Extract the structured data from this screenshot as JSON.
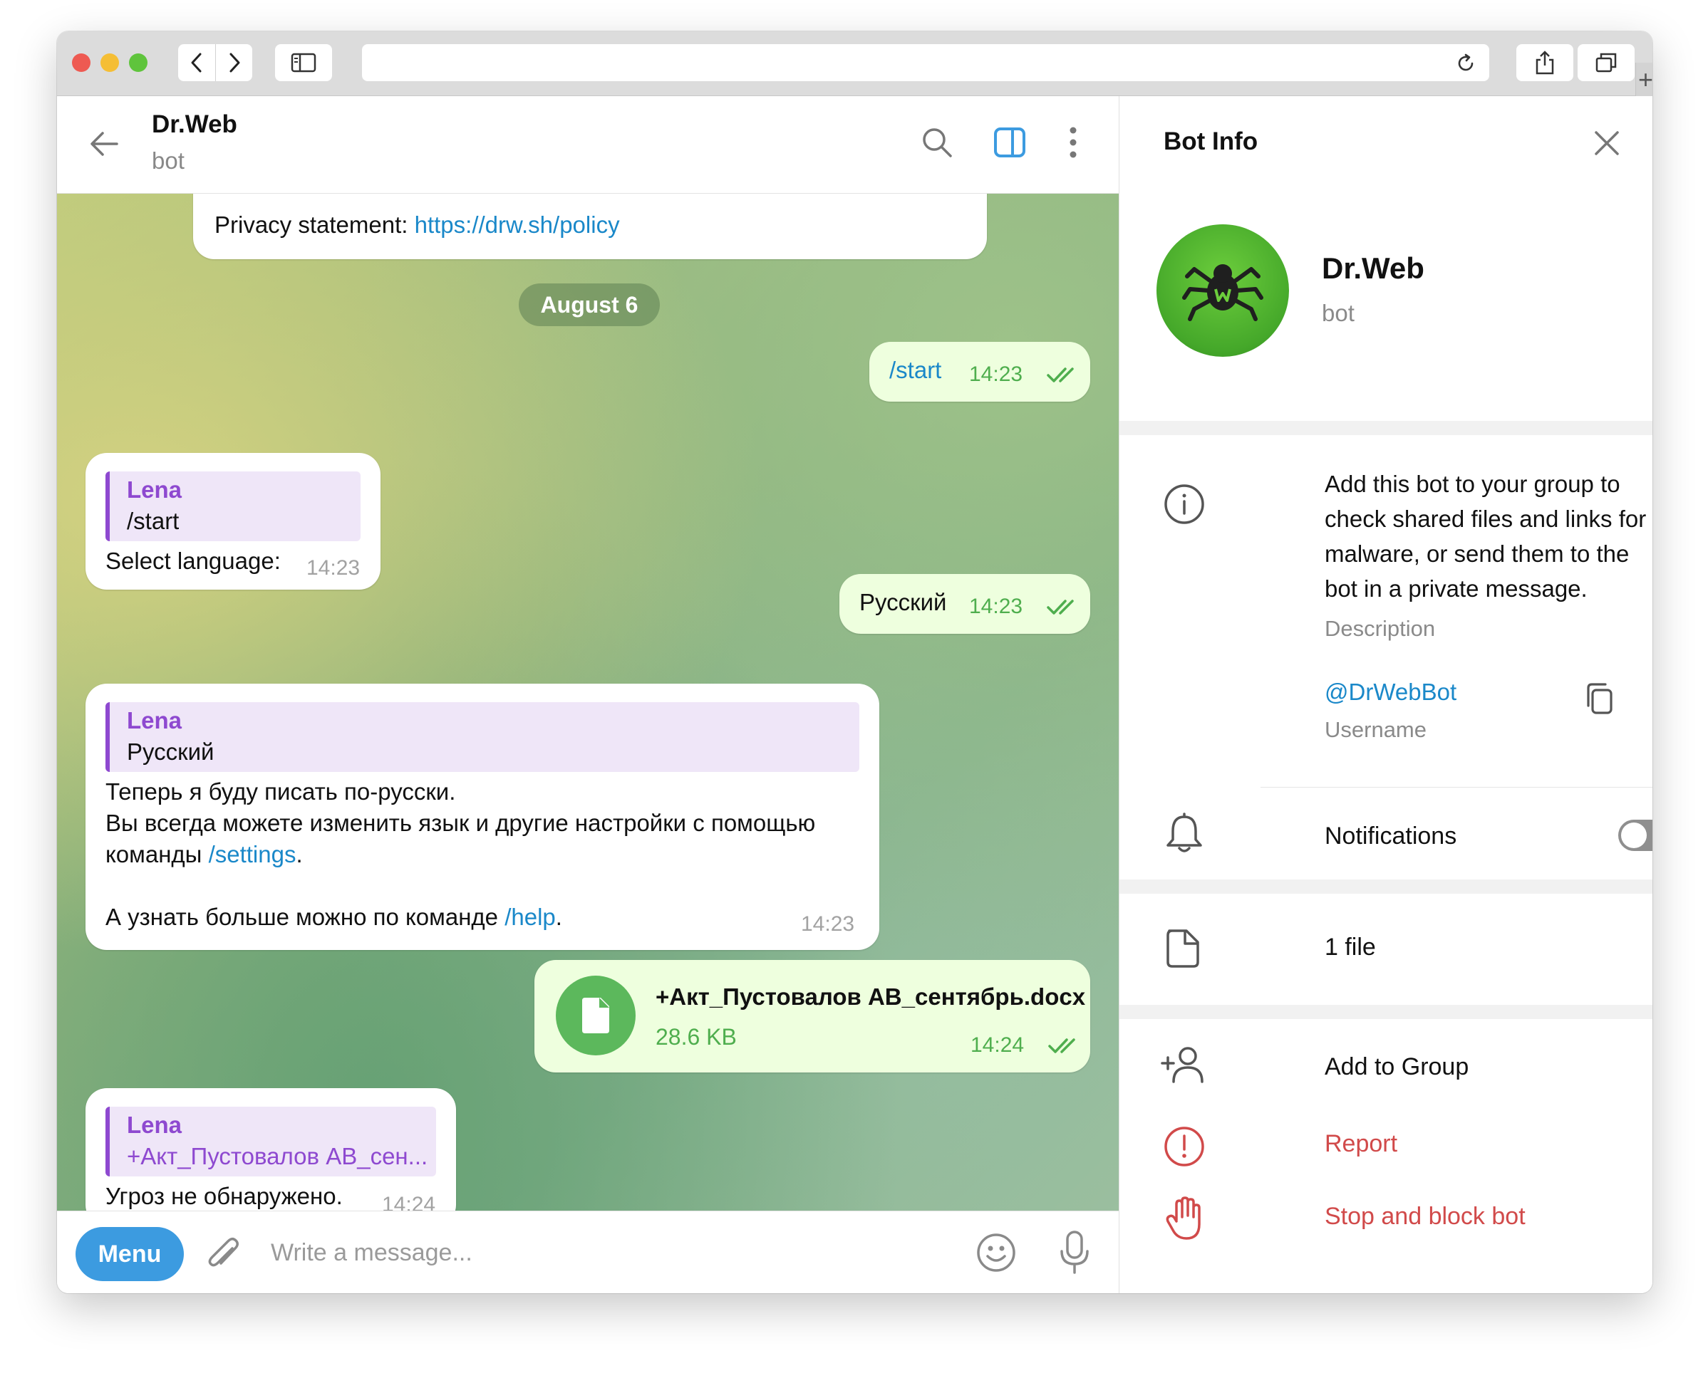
{
  "chat": {
    "title": "Dr.Web",
    "subtitle": "bot",
    "date_pill": "August 6",
    "messages": {
      "privacy_label": "Privacy statement: ",
      "privacy_link": "https://drw.sh/policy",
      "out_start": {
        "text": "/start",
        "time": "14:23"
      },
      "in_select": {
        "reply_name": "Lena",
        "reply_text": "/start",
        "text": "Select language:",
        "time": "14:23"
      },
      "out_russian": {
        "text": "Русский",
        "time": "14:23"
      },
      "in_russian": {
        "reply_name": "Lena",
        "reply_text": "Русский",
        "line1": "Теперь я буду писать по-русски.",
        "line2": "Вы всегда можете изменить язык и другие настройки с помощью",
        "line3_pre": "команды ",
        "line3_link": "/settings",
        "line3_post": ".",
        "line4_pre": "А узнать больше можно по команде ",
        "line4_link": "/help",
        "line4_post": ".",
        "time": "14:23"
      },
      "out_file": {
        "name": "+Акт_Пустовалов АВ_сентябрь.docx",
        "size": "28.6 KB",
        "time": "14:24"
      },
      "in_result": {
        "reply_name": "Lena",
        "reply_text": "+Акт_Пустовалов АВ_сен...",
        "text": "Угроз не обнаружено.",
        "time": "14:24"
      }
    }
  },
  "composer": {
    "menu_label": "Menu",
    "placeholder": "Write a message..."
  },
  "panel": {
    "title": "Bot Info",
    "name": "Dr.Web",
    "subtitle": "bot",
    "description_lines": [
      "Add this bot to your group to",
      "check shared files and links for",
      "malware, or send them to the",
      "bot in a private message."
    ],
    "description_caption": "Description",
    "username": "@DrWebBot",
    "username_caption": "Username",
    "notifications_label": "Notifications",
    "notifications_on": false,
    "files_label": "1 file",
    "add_to_group": "Add to Group",
    "report": "Report",
    "stop_block": "Stop and block bot"
  },
  "colors": {
    "accent": "#3c9be0",
    "outgoing_bubble": "#eeffde",
    "outgoing_time": "#4fae4e",
    "reply_accent": "#8e49d0",
    "link": "#1a88c9",
    "danger": "#d14a4a",
    "bot_avatar": "#45a82a"
  }
}
